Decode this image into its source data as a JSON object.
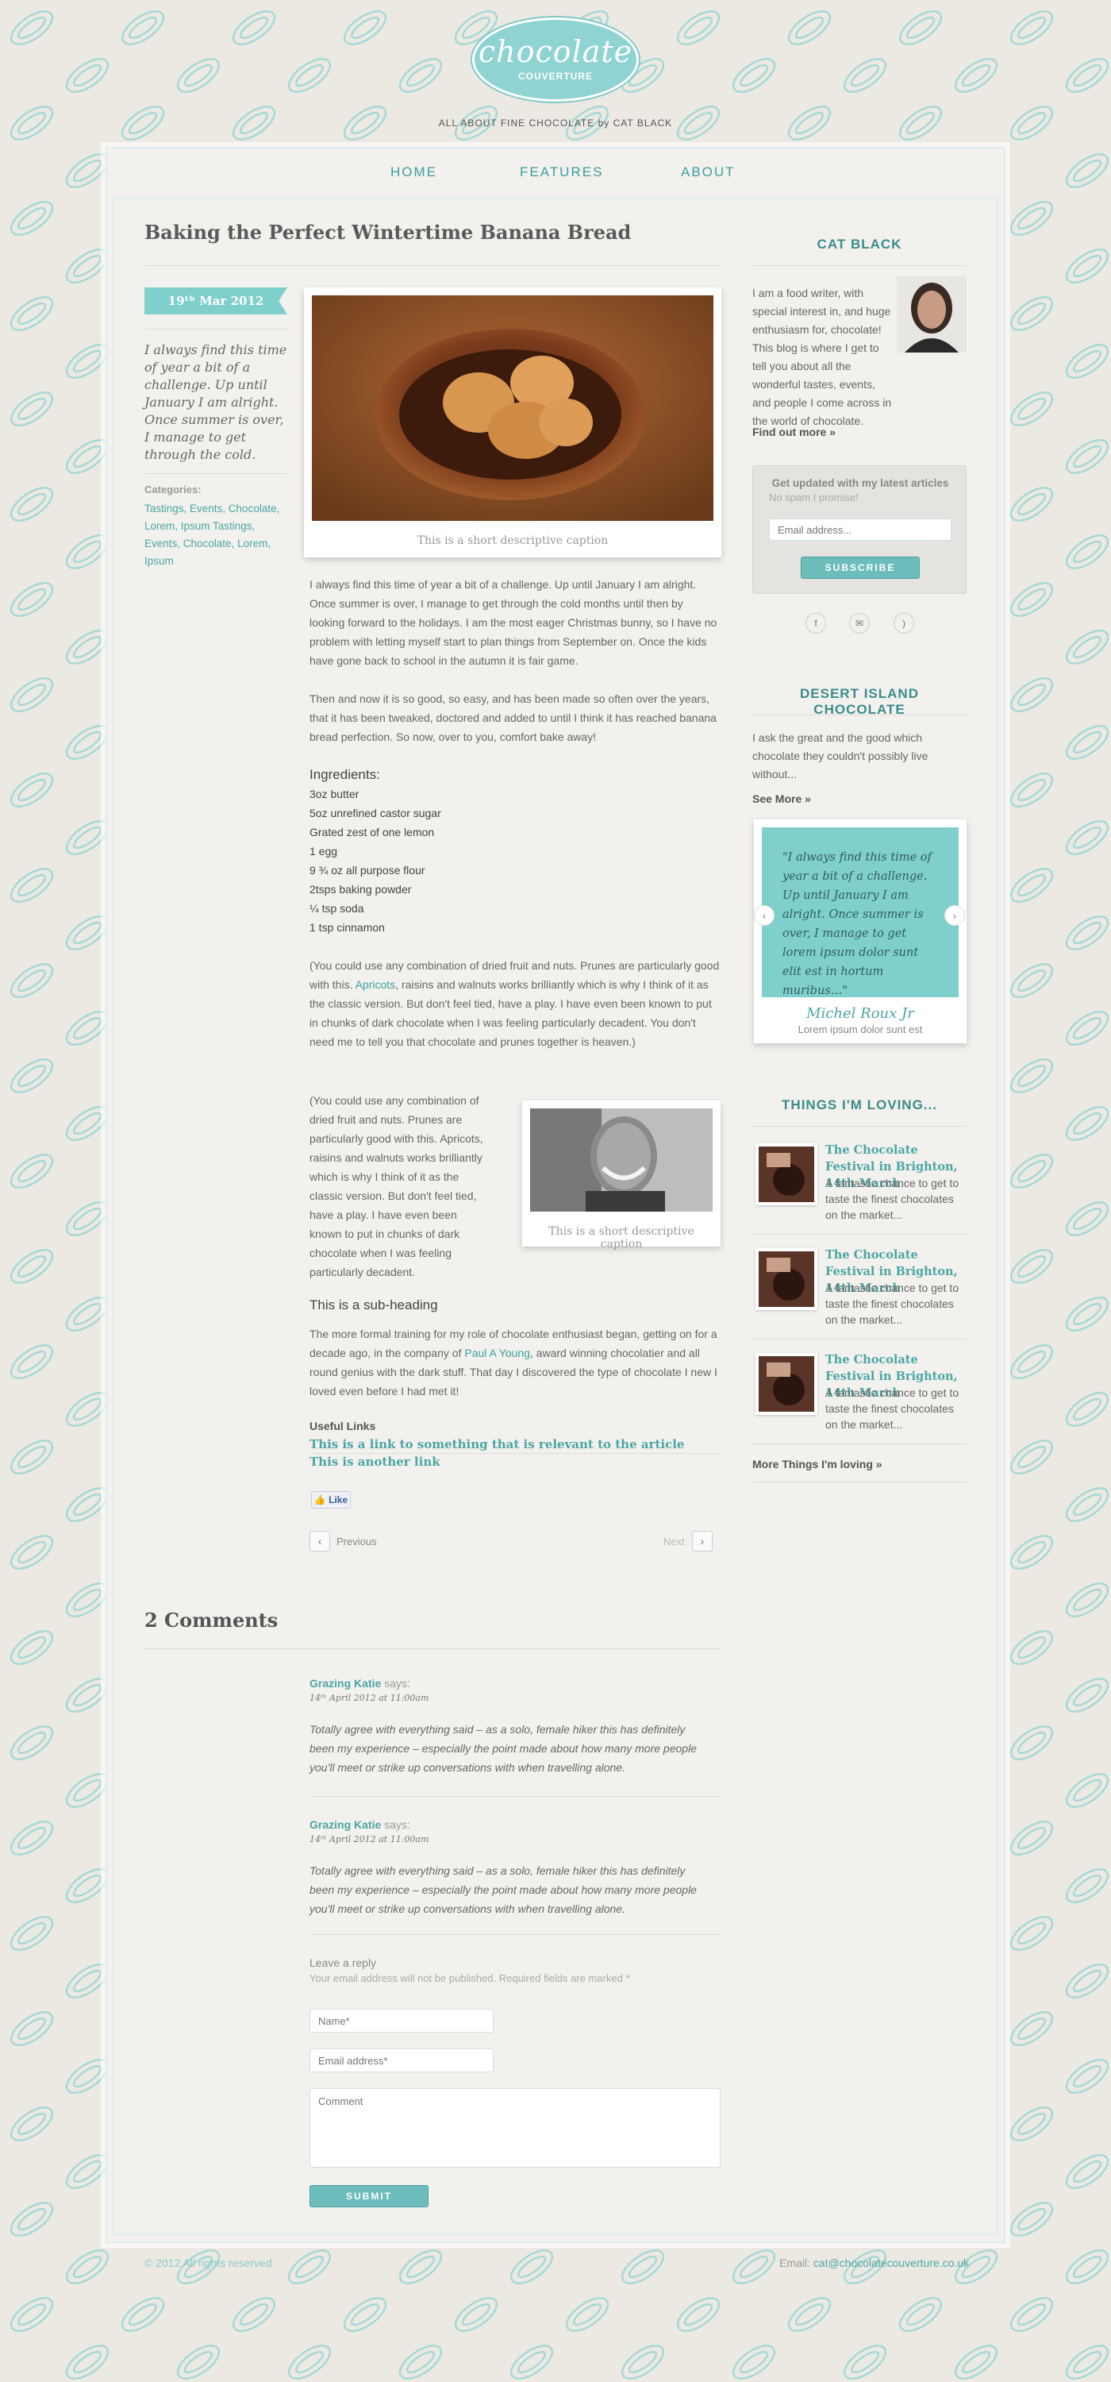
{
  "header": {
    "logo_main": "chocolate",
    "logo_sub": "COUVERTURE",
    "tagline": "ALL ABOUT FINE CHOCOLATE by CAT BLACK"
  },
  "nav": [
    {
      "label": "HOME"
    },
    {
      "label": "FEATURES"
    },
    {
      "label": "ABOUT"
    }
  ],
  "article": {
    "title": "Baking the Perfect Wintertime Banana Bread",
    "date": "19ᵗʰ Mar 2012",
    "intro": "I always find this time of year a bit of a challenge. Up until January I am alright. Once summer is over, I manage to get through the cold.",
    "categories_label": "Categories:",
    "categories": "Tastings, Events, Chocolate, Lorem, Ipsum Tastings, Events, Chocolate, Lorem, Ipsum",
    "caption1": "This is a short descriptive caption",
    "para1": "I always find this time of year a bit of a challenge. Up until January I am alright. Once summer is over, I manage to get through the cold months until then by looking forward to the holidays. I am the most eager Christmas bunny, so I have no problem with letting myself start to plan things from September on. Once the kids have gone back to school in the autumn it is fair game.",
    "para2": "Then and now it is so good, so easy, and has been made so often over the years, that it has been tweaked, doctored and added to until I think it has reached banana bread perfection. So now, over to you, comfort bake away!",
    "ingredients_heading": "Ingredients:",
    "ingredients": [
      "3oz butter",
      "5oz unrefined castor sugar",
      "Grated zest of one lemon",
      "1 egg",
      " 9 ¾ oz all purpose flour",
      "2tsps baking powder",
      "¼ tsp soda",
      "1 tsp cinnamon"
    ],
    "para3_a": "(You could use any combination of dried fruit and nuts. Prunes are particularly good with this. ",
    "para3_link": "Apricots",
    "para3_b": ", raisins and walnuts works brilliantly which is why I think of it as the classic version. But don't feel tied, have a play. I have even been known to put in chunks of dark chocolate when I was feeling particularly decadent. You don't need me to tell you that chocolate and prunes together is heaven.)",
    "para4": "(You could use any combination of dried fruit and nuts. Prunes are particularly good with this. Apricots, raisins and walnuts works brilliantly which is why I think of it as the classic version. But don't feel tied, have a play. I have even been known to put in chunks of dark chocolate when I was feeling particularly decadent.",
    "caption2": "This is a short descriptive caption",
    "subheading": "This is a sub-heading",
    "para5_a": "The more formal training for my role of chocolate enthusiast began, getting on for a decade ago, in the company of ",
    "para5_link": "Paul A Young",
    "para5_b": ", award winning chocolatier and all round genius with the dark stuff. That day I discovered the type of chocolate I new I loved even before I had met it!",
    "useful_links_heading": "Useful Links",
    "useful_links": [
      "This is a link to something that is relevant to the article",
      "This is another link"
    ],
    "like": "Like",
    "previous": "Previous",
    "next": "Next"
  },
  "comments": {
    "title": "2 Comments",
    "items": [
      {
        "author": "Grazing Katie",
        "says": " says:",
        "date": "14ᵗʰ April 2012 at 11:00am",
        "text": "Totally agree with everything said – as a solo, female hiker this has definitely been my experience – especially the point made about how many more people you'll meet or strike up conversations with when travelling alone."
      },
      {
        "author": "Grazing Katie",
        "says": " says:",
        "date": "14ᵗʰ April 2012 at 11:00am",
        "text": "Totally agree with everything said – as a solo, female hiker this has definitely been my experience – especially the point made about how many more people you'll meet or strike up conversations with when travelling alone."
      }
    ],
    "reply_heading": "Leave a reply",
    "reply_note": "Your email address will not be published. Required fields are marked *",
    "name_placeholder": "Name*",
    "email_placeholder": "Email address*",
    "comment_placeholder": "Comment",
    "submit": "SUBMIT"
  },
  "sidebar": {
    "author_heading": "CAT BLACK",
    "author_bio": "I am a food writer, with special interest in, and huge enthusiasm for, chocolate! This blog is where I get to tell you about all the wonderful tastes, events, and people I come across in the world of chocolate.",
    "find_out_more": "Find out more »",
    "signup_title": "Get updated with my latest articles",
    "signup_sub": "No spam I promise!",
    "email_placeholder": "Email address...",
    "subscribe": "SUBSCRIBE",
    "social_icons": [
      "facebook-icon",
      "email-icon",
      "rss-icon"
    ],
    "desert_heading": "DESERT ISLAND CHOCOLATE",
    "desert_text": "I ask the great and the good which chocolate they couldn't possibly live without...",
    "see_more": "See More »",
    "quote_text": "\"I always find this time of year a bit of a challenge. Up until January I am alright. Once summer is over, I manage to get lorem ipsum dolor sunt elit est in hortum muribus…\"",
    "quote_name": "Michel Roux Jr",
    "quote_sub": "Lorem ipsum dolor sunt est",
    "loving_heading": "THINGS I'M LOVING...",
    "loving_items": [
      {
        "title": "The Chocolate Festival in Brighton, 14th March",
        "text": "A fantastic chance to get to taste the finest chocolates on the market..."
      },
      {
        "title": "The Chocolate Festival in Brighton, 14th March",
        "text": "A fantastic chance to get to taste the finest chocolates on the market..."
      },
      {
        "title": "The Chocolate Festival in Brighton, 14th March",
        "text": "A fantastic chance to get to taste the finest chocolates on the market..."
      }
    ],
    "more_loving": "More Things I'm loving »"
  },
  "footer": {
    "copyright": "© 2012 All rights reserved",
    "email_label": "Email: ",
    "email": "cat@chocolatecouverture.co.uk"
  },
  "colors": {
    "accent": "#7fcfcd",
    "link": "#4aa6a5",
    "background": "#ece9e3"
  }
}
